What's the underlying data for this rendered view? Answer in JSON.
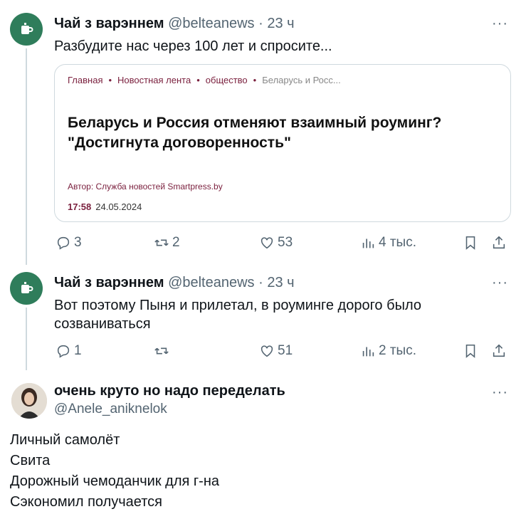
{
  "tweets": [
    {
      "author_name": "Чай з варэннем",
      "handle": "@belteanews",
      "time": "23 ч",
      "text": "Разбудите нас через 100 лет и спросите...",
      "card": {
        "breadcrumbs": [
          "Главная",
          "Новостная лента",
          "общество",
          "Беларусь и Росс..."
        ],
        "headline_line1": "Беларусь и Россия отменяют взаимный роуминг?",
        "headline_line2": "\"Достигнута договоренность\"",
        "author": "Автор: Служба новостей Smartpress.by",
        "time": "17:58",
        "date": "24.05.2024"
      },
      "replies": "3",
      "retweets": "2",
      "likes": "53",
      "views": "4 тыс."
    },
    {
      "author_name": "Чай з варэннем",
      "handle": "@belteanews",
      "time": "23 ч",
      "text_line1": "Вот поэтому Пыня и прилетал, в роуминге дорого было",
      "text_line2": "созваниваться",
      "replies": "1",
      "retweets": "",
      "likes": "51",
      "views": "2 тыс."
    }
  ],
  "reply": {
    "author_name": "очень круто но надо переделать",
    "handle": "@Anele_aniknelok",
    "lines": [
      "Личный самолёт",
      "Свита",
      "Дорожный чемоданчик для г-на",
      "Сэкономил получается"
    ]
  },
  "separator": "·",
  "more_label": "···",
  "colors": {
    "avatar": "#2f7d5b",
    "muted": "#536471",
    "card_accent": "#7a1f3d"
  }
}
